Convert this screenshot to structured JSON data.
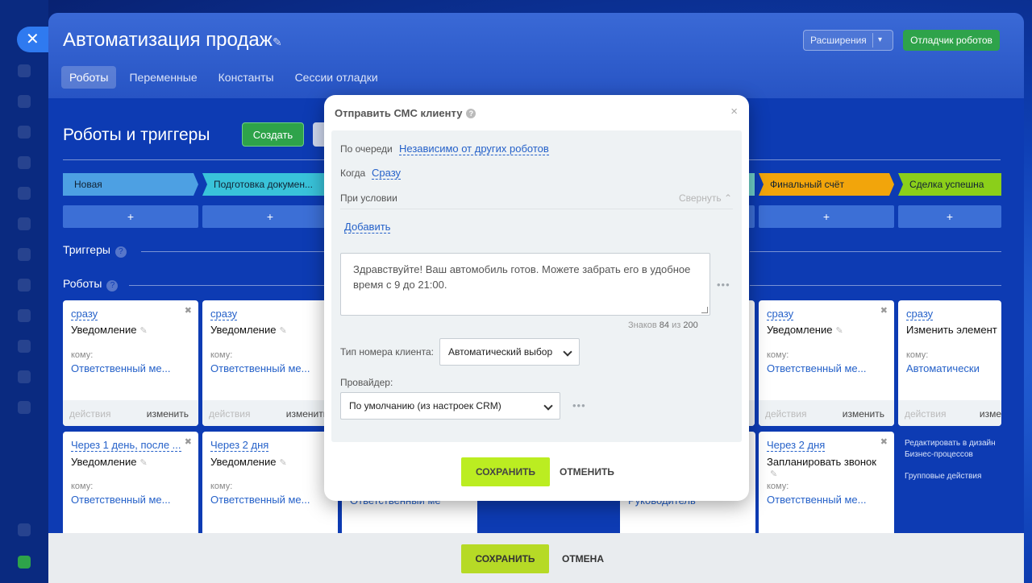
{
  "header": {
    "title": "Автоматизация продаж",
    "extensions_label": "Расширения",
    "debugger_label": "Отладчик роботов",
    "tabs": [
      {
        "label": "Роботы"
      },
      {
        "label": "Переменные"
      },
      {
        "label": "Константы"
      },
      {
        "label": "Сессии отладки"
      }
    ]
  },
  "main": {
    "heading": "Роботы и триггеры",
    "create_label": "Создать",
    "triggers_label": "Триггеры",
    "robots_label": "Роботы",
    "help_glyph": "?",
    "plus": "+",
    "stages": [
      {
        "label": "Новая",
        "color": "#4da0e3"
      },
      {
        "label": "Подготовка докумен...",
        "color": "#39c3da"
      },
      {
        "label": "Финальный счёт",
        "color": "#f2a50b"
      },
      {
        "label": "Сделка успешна",
        "color": "#8bcf1a"
      }
    ],
    "cards_row1": [
      {
        "when": "сразу",
        "name": "Уведомление",
        "to": "кому:",
        "who": "Ответственный ме...",
        "actions": "действия",
        "edit": "изменить"
      },
      {
        "when": "сразу",
        "name": "Уведомление",
        "to": "кому:",
        "who": "Ответственный ме...",
        "actions": "действия",
        "edit": "изменить"
      },
      {
        "when": "сразу",
        "name": "Уведомление",
        "to": "кому:",
        "who": "Ответственный ме...",
        "actions": "действия",
        "edit": "изменить"
      },
      {
        "when": "сразу",
        "name": "Изменить элемент",
        "to": "кому:",
        "who": "Автоматически",
        "actions": "действия",
        "edit": "изме"
      }
    ],
    "cards_row2": [
      {
        "when": "Через 1 день, после ...",
        "name": "Уведомление",
        "to": "кому:",
        "who": "Ответственный ме..."
      },
      {
        "when": "Через 2 дня",
        "name": "Уведомление",
        "to": "кому:",
        "who": "Ответственный ме..."
      },
      {
        "when": "Через 2 дня",
        "name": "Запланировать звонок",
        "to": "кому:",
        "who": "Ответственный ме..."
      }
    ],
    "hidden_fragments": [
      "Ответственный ме",
      "Руководитель"
    ],
    "side_links": [
      "Редактировать в дизайн",
      "Бизнес-процессов",
      "Групповые действия"
    ]
  },
  "footer": {
    "save_label": "СОХРАНИТЬ",
    "cancel_label": "ОТМЕНА"
  },
  "modal": {
    "title": "Отправить СМС клиенту",
    "close_glyph": "×",
    "queue_label": "По очереди",
    "queue_value": "Независимо от других роботов",
    "when_label": "Когда",
    "when_value": "Сразу",
    "condition_label": "При условии",
    "collapse_label": "Свернуть",
    "add_label": "Добавить",
    "message": "Здравствуйте! Ваш автомобиль готов. Можете забрать его в удобное время с 9 до 21:00.",
    "counter_label": "Знаков",
    "counter_value": "84",
    "counter_of": "из",
    "counter_max": "200",
    "number_type_label": "Тип номера клиента:",
    "number_type_value": "Автоматический выбор",
    "provider_label": "Провайдер:",
    "provider_value": "По умолчанию (из настроек CRM)",
    "more_glyph": "•••",
    "save_label": "СОХРАНИТЬ",
    "cancel_label": "ОТМЕНИТЬ"
  }
}
